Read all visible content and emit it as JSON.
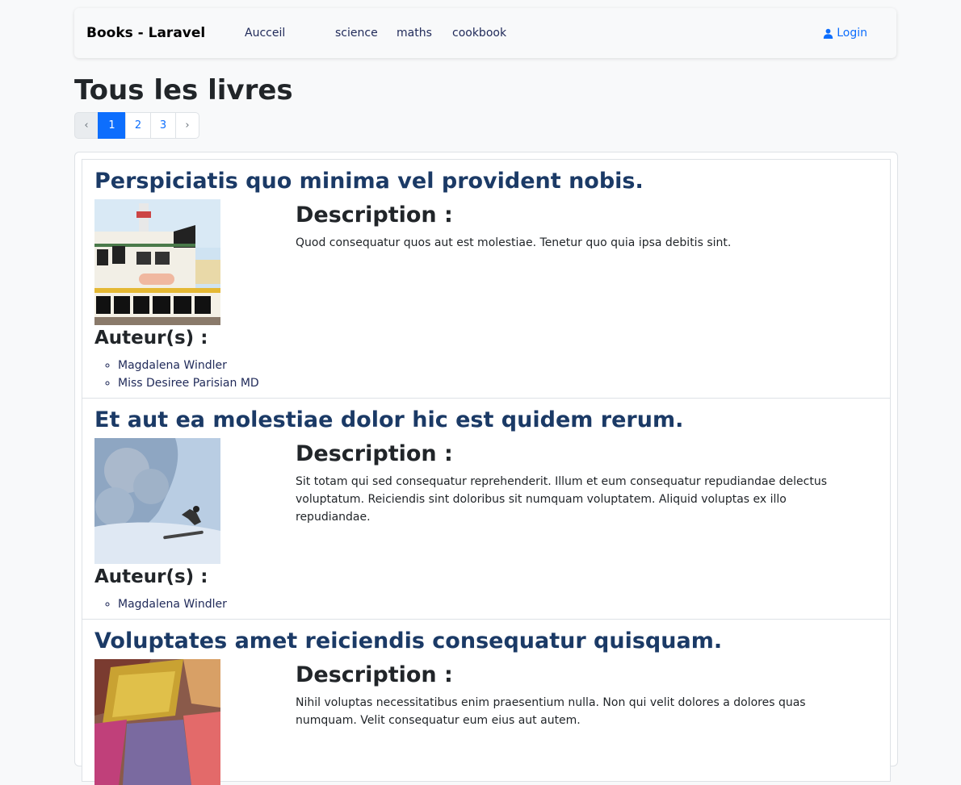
{
  "navbar": {
    "brand": "Books - Laravel",
    "links": [
      "Aucceil",
      "science",
      "maths",
      "cookbook"
    ],
    "login_label": "Login"
  },
  "page_title": "Tous les livres",
  "pagination": {
    "prev": "‹",
    "pages": [
      "1",
      "2",
      "3"
    ],
    "next": "›",
    "current": "1"
  },
  "labels": {
    "description": "Description :",
    "authors": "Auteur(s) :"
  },
  "books": [
    {
      "title": "Perspiciatis quo minima vel provident nobis.",
      "description": "Quod consequatur quos aut est molestiae. Tenetur quo quia ipsa debitis sint.",
      "authors": [
        "Magdalena Windler",
        "Miss Desiree Parisian MD"
      ]
    },
    {
      "title": "Et aut ea molestiae dolor hic est quidem rerum.",
      "description": "Sit totam qui sed consequatur reprehenderit. Illum et eum consequatur repudiandae delectus voluptatum. Reiciendis sint doloribus sit numquam voluptatem. Aliquid voluptas ex illo repudiandae.",
      "authors": [
        "Magdalena Windler"
      ]
    },
    {
      "title": "Voluptates amet reiciendis consequatur quisquam.",
      "description": "Nihil voluptas necessitatibus enim praesentium nulla. Non qui velit dolores a dolores quas numquam. Velit consequatur eum eius aut autem.",
      "authors": []
    }
  ],
  "colors": {
    "accent": "#0d6efd",
    "title": "#1b3a66",
    "background": "#f8f9fa"
  }
}
